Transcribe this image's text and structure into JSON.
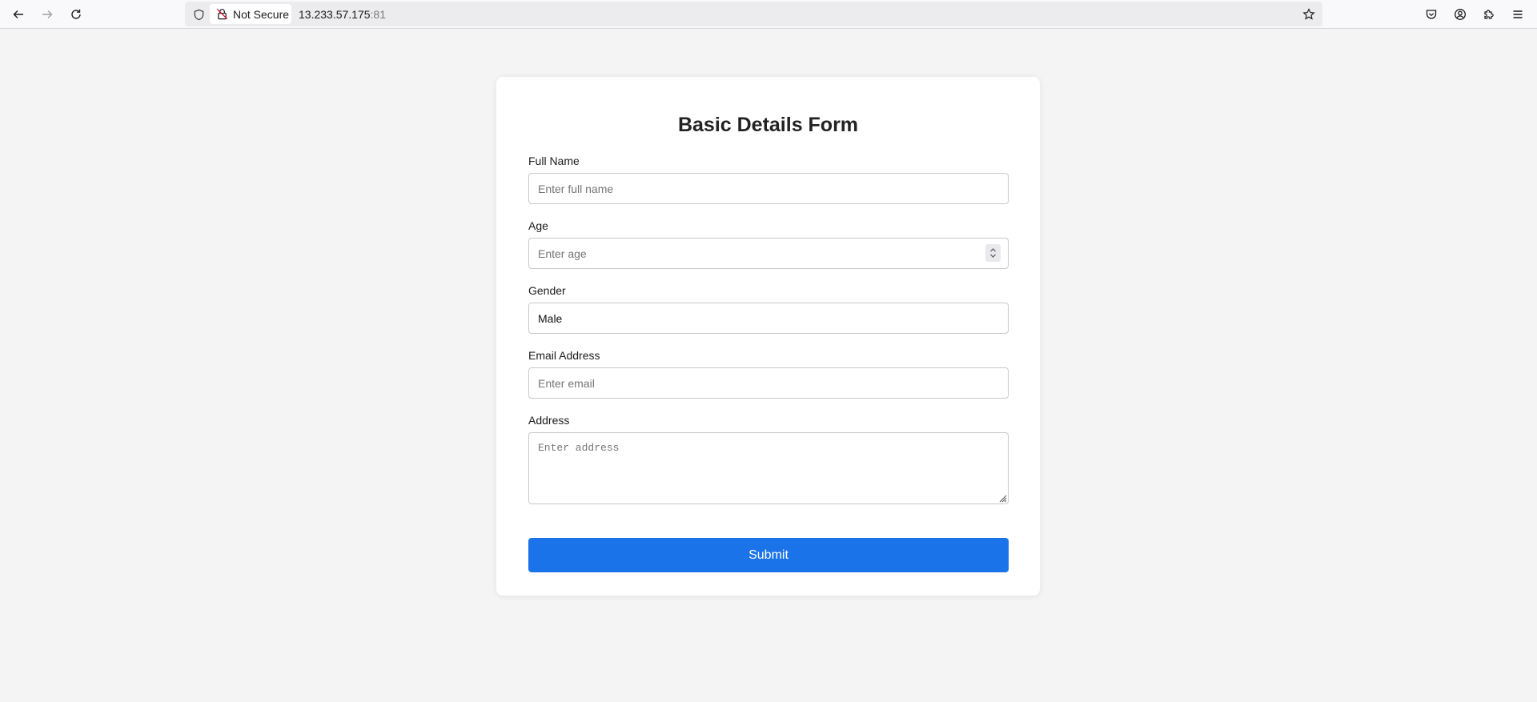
{
  "browser": {
    "security_label": "Not Secure",
    "url_host": "13.233.57.175",
    "url_port": ":81"
  },
  "form": {
    "title": "Basic Details Form",
    "full_name": {
      "label": "Full Name",
      "placeholder": "Enter full name",
      "value": ""
    },
    "age": {
      "label": "Age",
      "placeholder": "Enter age",
      "value": ""
    },
    "gender": {
      "label": "Gender",
      "selected": "Male"
    },
    "email": {
      "label": "Email Address",
      "placeholder": "Enter email",
      "value": ""
    },
    "address": {
      "label": "Address",
      "placeholder": "Enter address",
      "value": ""
    },
    "submit_label": "Submit"
  },
  "colors": {
    "page_background": "#f4f4f4",
    "submit_button": "#1a73e8"
  }
}
